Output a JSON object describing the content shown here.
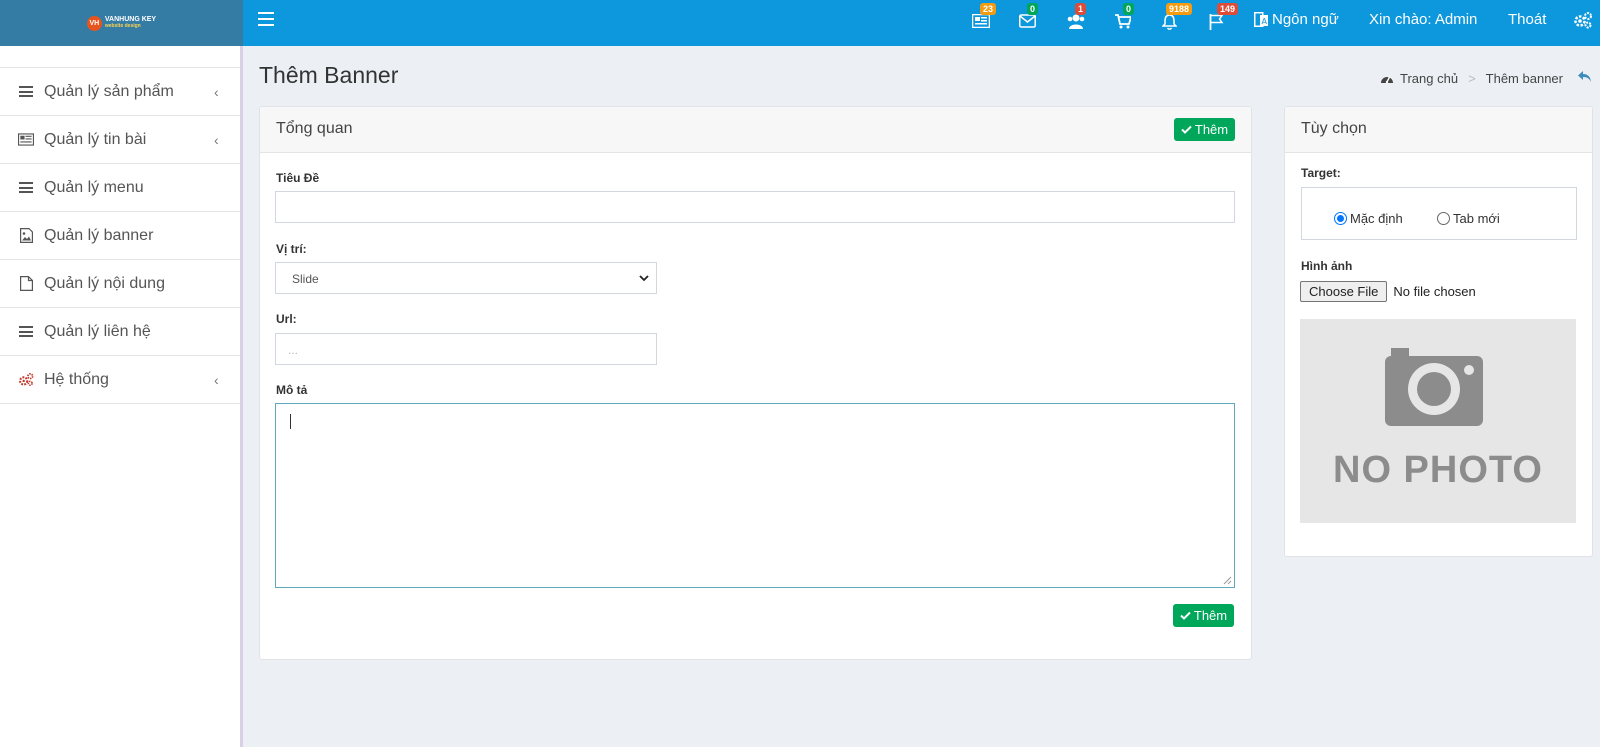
{
  "header": {
    "logo_text": "VANHUNG KEY",
    "logo_sub": "website design",
    "logo_mark": "VH",
    "notifications": [
      {
        "icon": "newspaper-icon",
        "count": "23",
        "color": "#f39c12"
      },
      {
        "icon": "envelope-icon",
        "count": "0",
        "color": "#00a65a"
      },
      {
        "icon": "users-icon",
        "count": "1",
        "color": "#dd4b39"
      },
      {
        "icon": "cart-icon",
        "count": "0",
        "color": "#00a65a"
      },
      {
        "icon": "bell-icon",
        "count": "9188",
        "color": "#f39c12"
      },
      {
        "icon": "flag-icon",
        "count": "149",
        "color": "#dd4b39"
      }
    ],
    "language": "Ngôn ngữ",
    "greeting": "Xin chào: Admin",
    "logout": "Thoát"
  },
  "sidebar": {
    "items": [
      {
        "label": "Quản lý sản phẩm",
        "icon": "bars-icon",
        "has_chevron": true
      },
      {
        "label": "Quản lý tin bài",
        "icon": "newspaper-icon",
        "has_chevron": true
      },
      {
        "label": "Quản lý menu",
        "icon": "bars-icon",
        "has_chevron": false
      },
      {
        "label": "Quản lý banner",
        "icon": "image-icon",
        "has_chevron": false
      },
      {
        "label": "Quản lý nội dung",
        "icon": "file-icon",
        "has_chevron": false
      },
      {
        "label": "Quản lý liên hệ",
        "icon": "bars-icon",
        "has_chevron": false
      },
      {
        "label": "Hệ thống",
        "icon": "gears-icon",
        "has_chevron": true
      }
    ]
  },
  "page": {
    "title": "Thêm Banner",
    "breadcrumb": {
      "home": "Trang chủ",
      "current": "Thêm banner"
    }
  },
  "overview": {
    "title": "Tổng quan",
    "add_label": "Thêm",
    "fields": {
      "title_label": "Tiêu Đề",
      "title_value": "",
      "position_label": "Vị trí:",
      "position_value": "Slide",
      "url_label": "Url:",
      "url_placeholder": "...",
      "desc_label": "Mô tả",
      "desc_value": ""
    }
  },
  "options": {
    "title": "Tùy chọn",
    "target_label": "Target:",
    "target_options": [
      {
        "label": "Mặc định",
        "checked": true
      },
      {
        "label": "Tab mới",
        "checked": false
      }
    ],
    "image_label": "Hình ảnh",
    "choose_file": "Choose File",
    "no_file": "No file chosen",
    "placeholder_text": "NO PHOTO"
  },
  "colors": {
    "topbar": "#0d98dd",
    "logo_bg": "#357ca5",
    "accent_green": "#00a65a"
  }
}
